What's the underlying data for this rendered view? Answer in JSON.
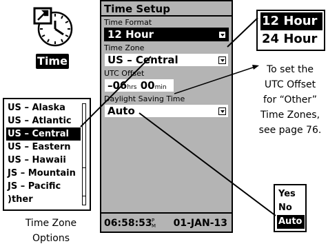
{
  "icon": {
    "name": "clock-wrench-icon",
    "label": "Time"
  },
  "screen": {
    "title": "Time Setup",
    "time_format": {
      "label": "Time Format",
      "value": "12 Hour"
    },
    "time_zone": {
      "label": "Time Zone",
      "value": "US – Central"
    },
    "utc_offset": {
      "label": "UTC Offset",
      "hours": "–06",
      "hrs_unit": "hrs",
      "minutes": "00",
      "min_unit": "min"
    },
    "dst": {
      "label": "Daylight Saving Time",
      "value": "Auto"
    },
    "status": {
      "time": "06:58:53",
      "ampm_top": "P",
      "ampm_bottom": "M",
      "date": "01-JAN-13"
    }
  },
  "format_popup": {
    "options": [
      "12 Hour",
      "24 Hour"
    ],
    "selected": 0
  },
  "tz_popup": {
    "options": [
      "US – Alaska",
      "US – Atlantic",
      "US – Central",
      "US – Eastern",
      "US – Hawaii",
      "JS – Mountain",
      "JS – Pacific",
      ")ther"
    ],
    "selected": 2
  },
  "tz_caption": {
    "line1": "Time Zone",
    "line2": "Options"
  },
  "dst_popup": {
    "options": [
      "Yes",
      "No",
      "Auto"
    ],
    "selected": 2
  },
  "note": {
    "lines": [
      "To set the",
      "UTC Offset",
      "for “Other”",
      "Time Zones,",
      "see page 76."
    ]
  }
}
